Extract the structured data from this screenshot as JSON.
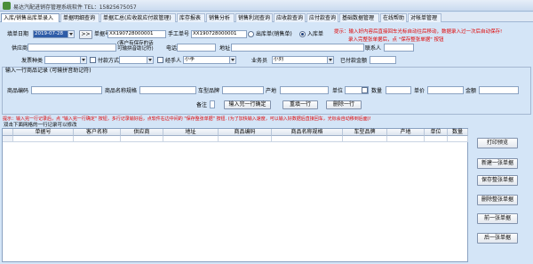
{
  "window": {
    "title": "易达汽配进销存管理系统软件 TEL：15825675057",
    "icon": "app-icon"
  },
  "tabs": [
    {
      "label": "入库/销售出库单录入"
    },
    {
      "label": "单据明细查询"
    },
    {
      "label": "单据汇总(应收款应付款管理)"
    },
    {
      "label": "库存报表"
    },
    {
      "label": "销售分析"
    },
    {
      "label": "销售利润查询"
    },
    {
      "label": "应收款查询"
    },
    {
      "label": "应付款查询"
    },
    {
      "label": "基础数据管理"
    },
    {
      "label": "在线帮助"
    },
    {
      "label": "对帐单管理"
    }
  ],
  "form": {
    "date_label": "填单日期",
    "date_value": "2019-07-28",
    "arrow_button": ">>",
    "doc_no_label": "单据号",
    "doc_no_value": "XX190728000001",
    "manual_no_label": "手工单号",
    "manual_no_value": "XX190728000001",
    "radio_out": "出库单(销售单)",
    "radio_in": "入库单",
    "hint1": "提示：输入好内容后直接回车光标自动往后移动，数据录入过一次后自动保存!",
    "hint2": "录入完整张单据后，点 \"保存整张单据\" 按钮",
    "supplier_label": "供应商",
    "customer_label": "(客户有保存的话\n可输拼音助记符)",
    "phone_label": "电话",
    "address_label": "地址",
    "contact_label": "联系人",
    "invoice_label": "发票种类",
    "payment_label": "付款方式",
    "handler_label": "经手人",
    "handler_value": "小李",
    "salesman_label": "业务员",
    "salesman_value": "小刘",
    "paid_label": "已付款金额"
  },
  "item_section": {
    "title": "输入一行商品记录 (可输拼音助记符)",
    "code_label": "商品编码",
    "name_label": "商品名称规格",
    "model_label": "车型品牌",
    "origin_label": "产地",
    "unit_label": "单位",
    "qty_label": "数量",
    "price_label": "单价",
    "amount_label": "金额",
    "remark_label": "备注",
    "confirm_button": "输入完一行确定",
    "reset_button": "重填一行",
    "delete_button": "删除一行"
  },
  "hint3": "提示：输入完一行记录后，点 \"输入完一行确定\" 按钮，多行记录输好后，点软件右边中间的 \"保存整张单据\" 按钮. (为了加快输入速度，可以输入好数据后直接回车，光标会自动移到后面)!",
  "grid": {
    "caption": "双击下面网格的一行记录可以修改",
    "columns": [
      "单据号",
      "客户名称",
      "供应商",
      "地址",
      "商品编码",
      "商品名称规格",
      "车型品牌",
      "产地",
      "单位",
      "数量"
    ]
  },
  "side_buttons": {
    "print": "打印预览",
    "new": "新建一张单据",
    "save": "保存整张单据",
    "delete": "删除整张单据",
    "prev": "前一张单据",
    "next": "后一张单据"
  },
  "colors": {
    "background": "#d4e5f7",
    "hint_red": "#e00000",
    "selected": "#2f5da8"
  }
}
